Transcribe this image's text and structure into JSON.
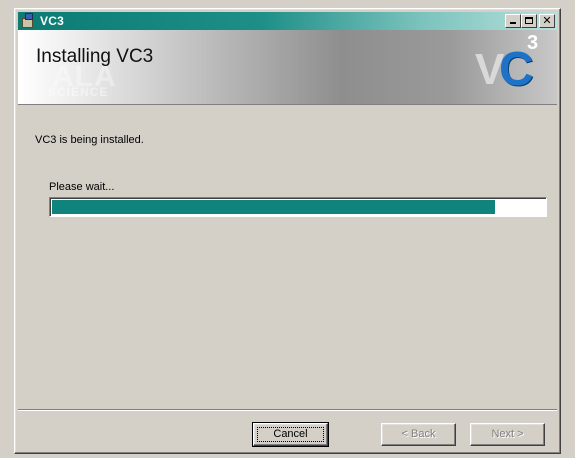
{
  "window": {
    "title": "VC3"
  },
  "banner": {
    "title": "Installing VC3",
    "watermark": "ALA",
    "watermark_sub": "SCIENCE",
    "logo_v": "V",
    "logo_c": "C",
    "logo_sup": "3"
  },
  "content": {
    "status": "VC3 is being installed.",
    "wait_label": "Please wait...",
    "progress_fraction": 0.9
  },
  "buttons": {
    "cancel": "Cancel",
    "back": "< Back",
    "next": "Next >"
  },
  "colors": {
    "titlebar_start": "#0a7c74",
    "progress_fill": "#0f847c",
    "logo_blue": "#1e73c8",
    "dialog_bg": "#d4d0c8"
  },
  "icons": {
    "app": "installer-icon",
    "minimize": "minimize-icon",
    "maximize": "maximize-icon",
    "close": "close-icon"
  }
}
